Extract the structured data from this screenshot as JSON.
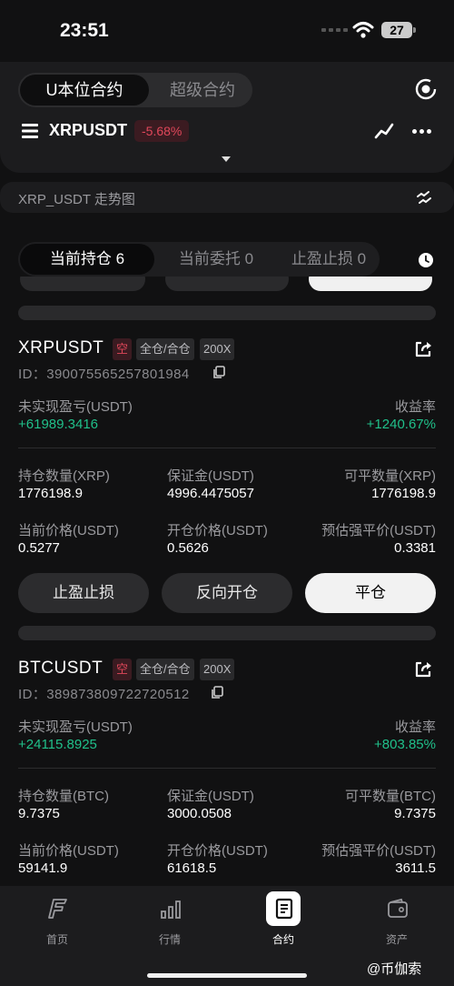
{
  "status": {
    "time": "23:51",
    "battery": "27"
  },
  "header": {
    "mode_tabs": [
      "U本位合约",
      "超级合约"
    ],
    "symbol": "XRPUSDT",
    "change": "-5.68%"
  },
  "chart_bar": {
    "label": "XRP_USDT 走势图"
  },
  "position_tabs": [
    "当前持仓 6",
    "当前委托 0",
    "止盈止损 0"
  ],
  "labels": {
    "unrealized": "未实现盈亏(USDT)",
    "roe": "收益率",
    "margin": "保证金(USDT)",
    "mark_price": "当前价格(USDT)",
    "entry_price": "开仓价格(USDT)",
    "liq_price": "预估强平价(USDT)"
  },
  "positions": [
    {
      "symbol": "XRPUSDT",
      "side": "空",
      "margin_mode": "全仓/合仓",
      "leverage": "200X",
      "id": "ID：390075565257801984",
      "unrealized": "+61989.3416",
      "roe": "+1240.67%",
      "qty_label": "持仓数量(XRP)",
      "qty": "1776198.9",
      "margin": "4996.4475057",
      "closable_label": "可平数量(XRP)",
      "closable": "1776198.9",
      "mark_price": "0.5277",
      "entry_price": "0.5626",
      "liq_price": "0.3381"
    },
    {
      "symbol": "BTCUSDT",
      "side": "空",
      "margin_mode": "全仓/合仓",
      "leverage": "200X",
      "id": "ID：389873809722720512",
      "unrealized": "+24115.8925",
      "roe": "+803.85%",
      "qty_label": "持仓数量(BTC)",
      "qty": "9.7375",
      "margin": "3000.0508",
      "closable_label": "可平数量(BTC)",
      "closable": "9.7375",
      "mark_price": "59141.9",
      "entry_price": "61618.5",
      "liq_price": "3611.5"
    }
  ],
  "actions": {
    "tpsl": "止盈止损",
    "reverse": "反向开仓",
    "close": "平仓"
  },
  "nav": [
    "首页",
    "行情",
    "合约",
    "资产"
  ],
  "watermark": "@币伽索"
}
